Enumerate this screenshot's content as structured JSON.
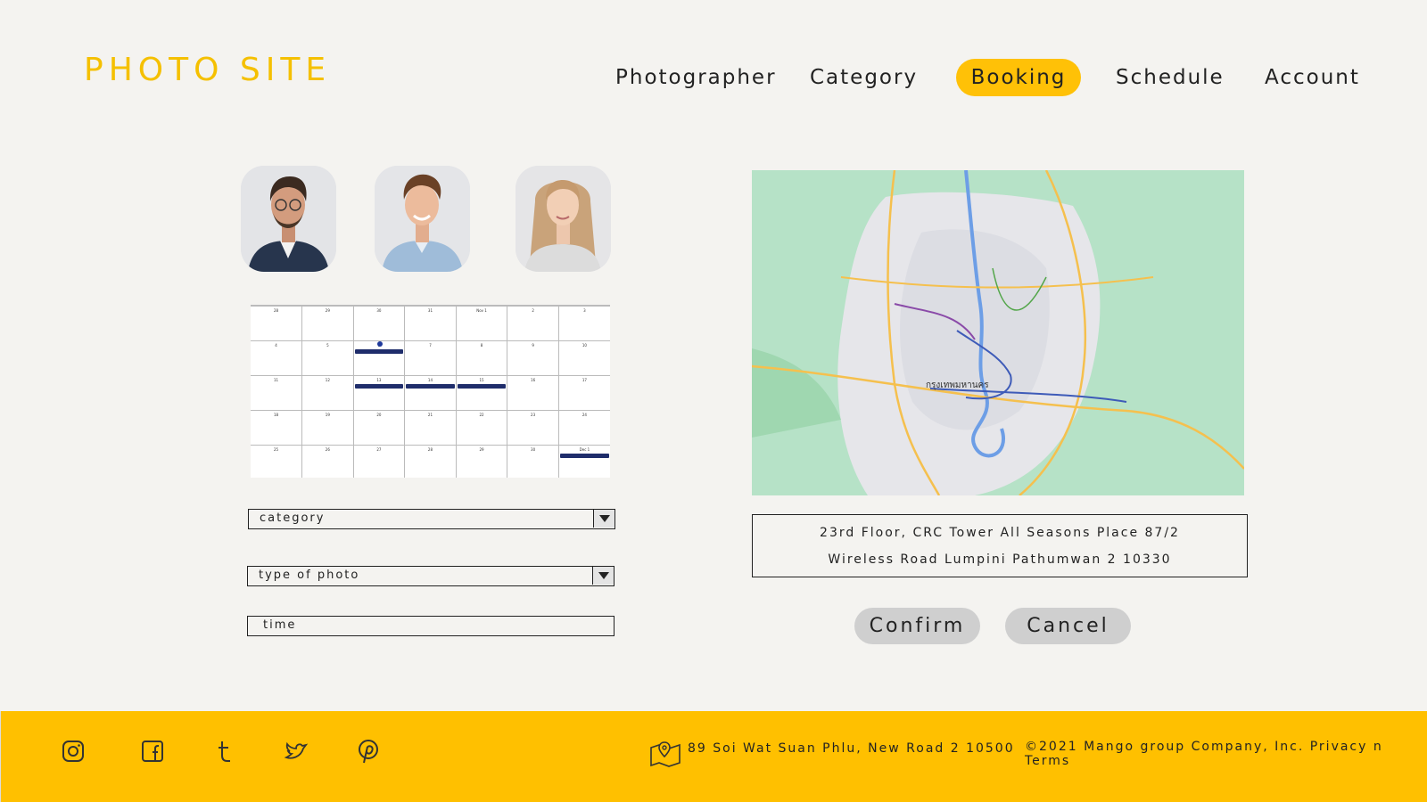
{
  "brand": {
    "logo_text": "PHOTO SITE",
    "accent_color": "#ffc107"
  },
  "nav": {
    "items": [
      {
        "label": "Photographer",
        "active": false
      },
      {
        "label": "Category",
        "active": false
      },
      {
        "label": "Booking",
        "active": true
      },
      {
        "label": "Schedule",
        "active": false
      },
      {
        "label": "Account",
        "active": false
      }
    ]
  },
  "photographers": [
    {
      "name": "photographer-1"
    },
    {
      "name": "photographer-2"
    },
    {
      "name": "photographer-3"
    }
  ],
  "calendar": {
    "rows": [
      [
        "28",
        "29",
        "30",
        "31",
        "Nov 1",
        "2",
        "3"
      ],
      [
        "4",
        "5",
        "6",
        "7",
        "8",
        "9",
        "10"
      ],
      [
        "11",
        "12",
        "13",
        "14",
        "15",
        "16",
        "17"
      ],
      [
        "18",
        "19",
        "20",
        "21",
        "22",
        "23",
        "24"
      ],
      [
        "25",
        "26",
        "27",
        "28",
        "29",
        "30",
        "Dec 1"
      ]
    ]
  },
  "form": {
    "category_value": "category",
    "type_value": "type of photo",
    "time_value": "time"
  },
  "map": {
    "city_label": "กรุงเทพมหานคร"
  },
  "address": {
    "line1": "23rd Floor, CRC Tower All Seasons Place 87/2",
    "line2": "Wireless Road Lumpini Pathumwan 2 10330"
  },
  "actions": {
    "confirm_label": "Confirm",
    "cancel_label": "Cancel"
  },
  "footer": {
    "social_icons": [
      "instagram-icon",
      "facebook-icon",
      "tumblr-icon",
      "twitter-icon",
      "pinterest-icon"
    ],
    "address": "89 Soi Wat Suan Phlu, New Road 2 10500",
    "copyright": "©2021 Mango group Company, Inc. Privacy n Terms",
    "background_color": "#ffc000"
  }
}
